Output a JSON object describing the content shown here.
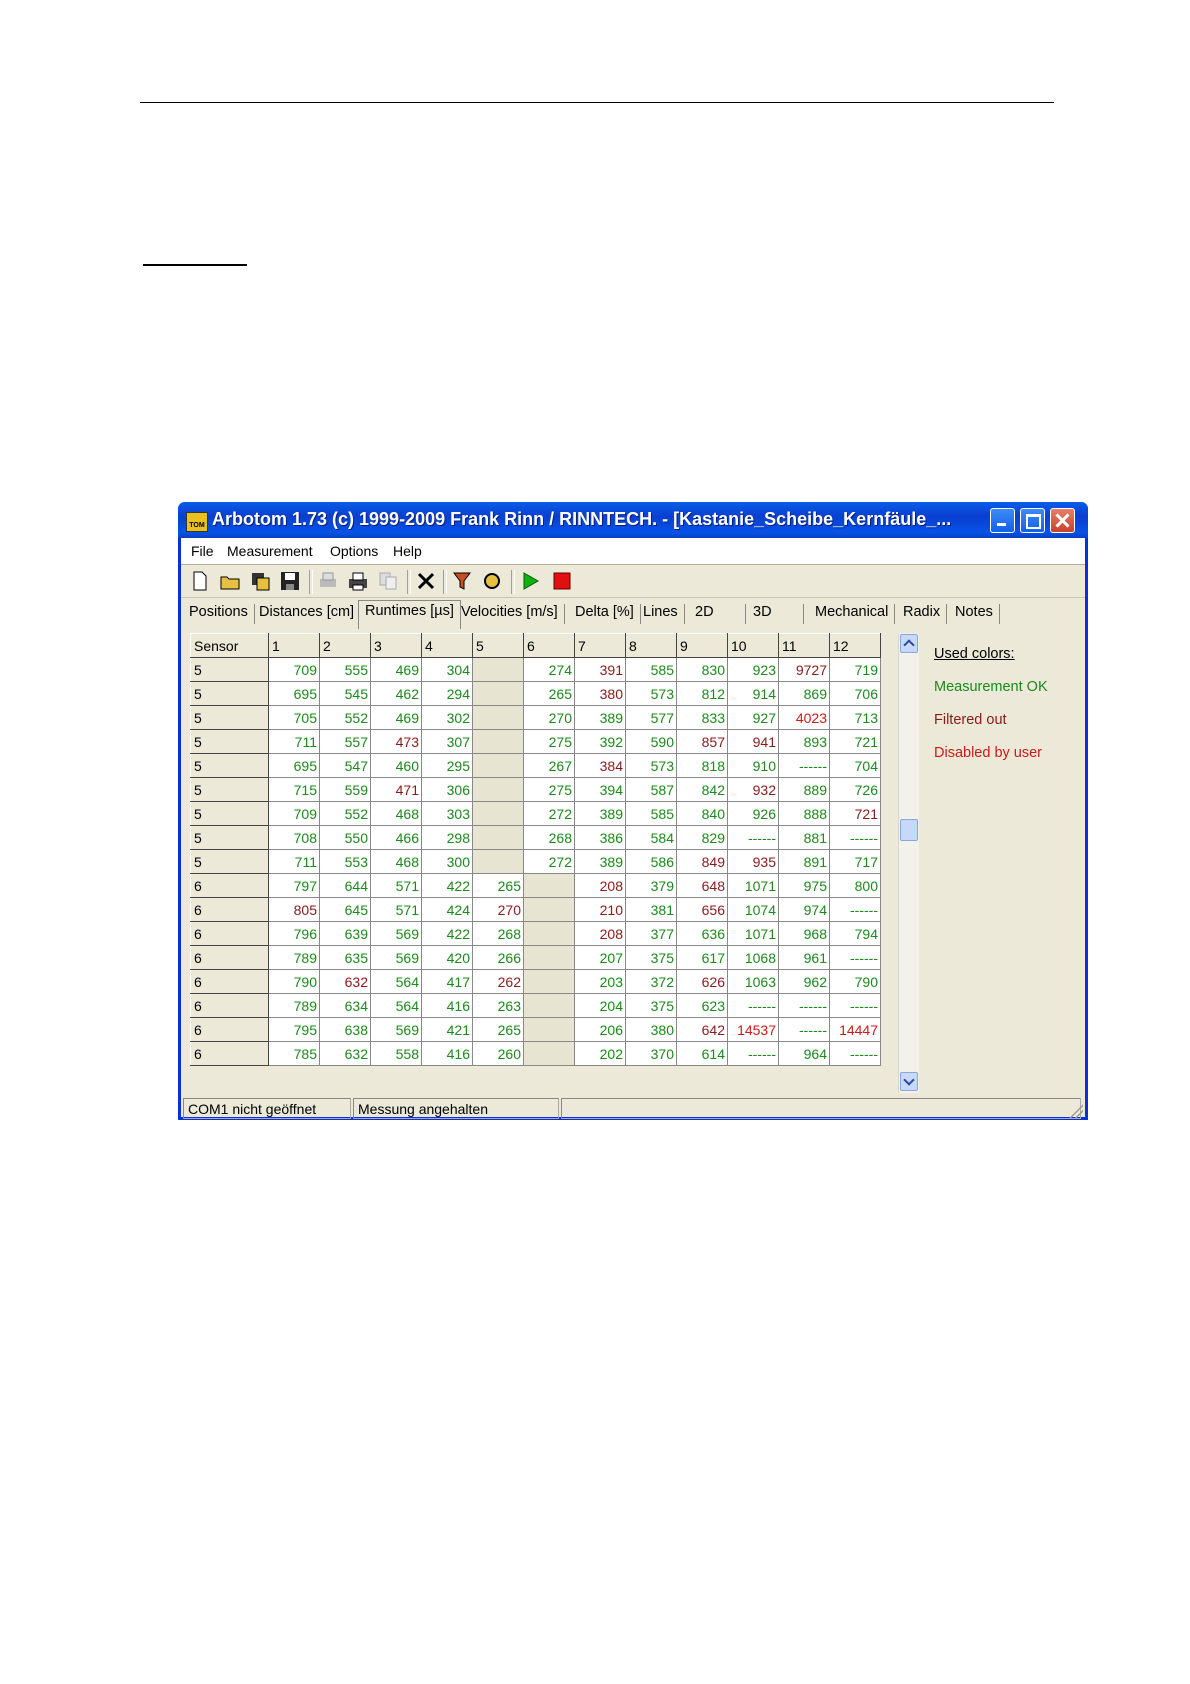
{
  "window": {
    "title": "Arbotom 1.73 (c) 1999-2009 Frank Rinn / RINNTECH.  - [Kastanie_Scheibe_Kernfäule_...",
    "icon_label": "TOM"
  },
  "menu": [
    "File",
    "Measurement",
    "Options",
    "Help"
  ],
  "toolbar": [
    "new-file-icon",
    "open-folder-icon",
    "save-all-icon",
    "save-icon",
    "print-preview-icon",
    "print-icon",
    "copy-icon",
    "delete-icon",
    "filter-icon",
    "refresh-icon",
    "play-icon",
    "stop-icon"
  ],
  "tabs": [
    "Positions",
    "Distances [cm]",
    "Runtimes [µs]",
    "Velocities [m/s]",
    "Delta [%]",
    "Lines",
    "2D",
    "3D",
    "Mechanical",
    "Radix",
    "Notes"
  ],
  "active_tab": "Runtimes [µs]",
  "grid": {
    "headers": [
      "Sensor",
      "1",
      "2",
      "3",
      "4",
      "5",
      "6",
      "7",
      "8",
      "9",
      "10",
      "11",
      "12"
    ],
    "rows": [
      {
        "sensor": "5",
        "cells": [
          [
            "709",
            "ok"
          ],
          [
            "555",
            "ok"
          ],
          [
            "469",
            "ok"
          ],
          [
            "304",
            "ok"
          ],
          [
            "",
            "blank"
          ],
          [
            "274",
            "ok"
          ],
          [
            "391",
            "filt"
          ],
          [
            "585",
            "ok"
          ],
          [
            "830",
            "ok"
          ],
          [
            "923",
            "ok"
          ],
          [
            "9727",
            "filt"
          ],
          [
            "719",
            "ok"
          ]
        ]
      },
      {
        "sensor": "5",
        "cells": [
          [
            "695",
            "ok"
          ],
          [
            "545",
            "ok"
          ],
          [
            "462",
            "ok"
          ],
          [
            "294",
            "ok"
          ],
          [
            "",
            "blank"
          ],
          [
            "265",
            "ok"
          ],
          [
            "380",
            "filt"
          ],
          [
            "573",
            "ok"
          ],
          [
            "812",
            "ok"
          ],
          [
            "914",
            "ok"
          ],
          [
            "869",
            "ok"
          ],
          [
            "706",
            "ok"
          ]
        ]
      },
      {
        "sensor": "5",
        "cells": [
          [
            "705",
            "ok"
          ],
          [
            "552",
            "ok"
          ],
          [
            "469",
            "ok"
          ],
          [
            "302",
            "ok"
          ],
          [
            "",
            "blank"
          ],
          [
            "270",
            "ok"
          ],
          [
            "389",
            "ok"
          ],
          [
            "577",
            "ok"
          ],
          [
            "833",
            "ok"
          ],
          [
            "927",
            "ok"
          ],
          [
            "4023",
            "dis"
          ],
          [
            "713",
            "ok"
          ]
        ]
      },
      {
        "sensor": "5",
        "cells": [
          [
            "711",
            "ok"
          ],
          [
            "557",
            "ok"
          ],
          [
            "473",
            "filt"
          ],
          [
            "307",
            "ok"
          ],
          [
            "",
            "blank"
          ],
          [
            "275",
            "ok"
          ],
          [
            "392",
            "ok"
          ],
          [
            "590",
            "ok"
          ],
          [
            "857",
            "filt"
          ],
          [
            "941",
            "filt"
          ],
          [
            "893",
            "ok"
          ],
          [
            "721",
            "ok"
          ]
        ]
      },
      {
        "sensor": "5",
        "cells": [
          [
            "695",
            "ok"
          ],
          [
            "547",
            "ok"
          ],
          [
            "460",
            "ok"
          ],
          [
            "295",
            "ok"
          ],
          [
            "",
            "blank"
          ],
          [
            "267",
            "ok"
          ],
          [
            "384",
            "filt"
          ],
          [
            "573",
            "ok"
          ],
          [
            "818",
            "ok"
          ],
          [
            "910",
            "ok"
          ],
          [
            "------",
            "ok"
          ],
          [
            "704",
            "ok"
          ]
        ]
      },
      {
        "sensor": "5",
        "cells": [
          [
            "715",
            "ok"
          ],
          [
            "559",
            "ok"
          ],
          [
            "471",
            "filt"
          ],
          [
            "306",
            "ok"
          ],
          [
            "",
            "blank"
          ],
          [
            "275",
            "ok"
          ],
          [
            "394",
            "ok"
          ],
          [
            "587",
            "ok"
          ],
          [
            "842",
            "ok"
          ],
          [
            "932",
            "filt"
          ],
          [
            "889",
            "ok"
          ],
          [
            "726",
            "ok"
          ]
        ]
      },
      {
        "sensor": "5",
        "cells": [
          [
            "709",
            "ok"
          ],
          [
            "552",
            "ok"
          ],
          [
            "468",
            "ok"
          ],
          [
            "303",
            "ok"
          ],
          [
            "",
            "blank"
          ],
          [
            "272",
            "ok"
          ],
          [
            "389",
            "ok"
          ],
          [
            "585",
            "ok"
          ],
          [
            "840",
            "ok"
          ],
          [
            "926",
            "ok"
          ],
          [
            "888",
            "ok"
          ],
          [
            "721",
            "filt"
          ]
        ]
      },
      {
        "sensor": "5",
        "cells": [
          [
            "708",
            "ok"
          ],
          [
            "550",
            "ok"
          ],
          [
            "466",
            "ok"
          ],
          [
            "298",
            "ok"
          ],
          [
            "",
            "blank"
          ],
          [
            "268",
            "ok"
          ],
          [
            "386",
            "ok"
          ],
          [
            "584",
            "ok"
          ],
          [
            "829",
            "ok"
          ],
          [
            "------",
            "ok"
          ],
          [
            "881",
            "ok"
          ],
          [
            "------",
            "ok"
          ]
        ]
      },
      {
        "sensor": "5",
        "cells": [
          [
            "711",
            "ok"
          ],
          [
            "553",
            "ok"
          ],
          [
            "468",
            "ok"
          ],
          [
            "300",
            "ok"
          ],
          [
            "",
            "blank"
          ],
          [
            "272",
            "ok"
          ],
          [
            "389",
            "ok"
          ],
          [
            "586",
            "ok"
          ],
          [
            "849",
            "filt"
          ],
          [
            "935",
            "filt"
          ],
          [
            "891",
            "ok"
          ],
          [
            "717",
            "ok"
          ]
        ]
      },
      {
        "sensor": "6",
        "cells": [
          [
            "797",
            "ok"
          ],
          [
            "644",
            "ok"
          ],
          [
            "571",
            "ok"
          ],
          [
            "422",
            "ok"
          ],
          [
            "265",
            "ok"
          ],
          [
            "",
            "blank"
          ],
          [
            "208",
            "filt"
          ],
          [
            "379",
            "ok"
          ],
          [
            "648",
            "filt"
          ],
          [
            "1071",
            "ok"
          ],
          [
            "975",
            "ok"
          ],
          [
            "800",
            "ok"
          ]
        ]
      },
      {
        "sensor": "6",
        "cells": [
          [
            "805",
            "filt"
          ],
          [
            "645",
            "ok"
          ],
          [
            "571",
            "ok"
          ],
          [
            "424",
            "ok"
          ],
          [
            "270",
            "filt"
          ],
          [
            "",
            "blank"
          ],
          [
            "210",
            "filt"
          ],
          [
            "381",
            "ok"
          ],
          [
            "656",
            "filt"
          ],
          [
            "1074",
            "ok"
          ],
          [
            "974",
            "ok"
          ],
          [
            "------",
            "ok"
          ]
        ]
      },
      {
        "sensor": "6",
        "cells": [
          [
            "796",
            "ok"
          ],
          [
            "639",
            "ok"
          ],
          [
            "569",
            "ok"
          ],
          [
            "422",
            "ok"
          ],
          [
            "268",
            "ok"
          ],
          [
            "",
            "blank"
          ],
          [
            "208",
            "filt"
          ],
          [
            "377",
            "ok"
          ],
          [
            "636",
            "ok"
          ],
          [
            "1071",
            "ok"
          ],
          [
            "968",
            "ok"
          ],
          [
            "794",
            "ok"
          ]
        ]
      },
      {
        "sensor": "6",
        "cells": [
          [
            "789",
            "ok"
          ],
          [
            "635",
            "ok"
          ],
          [
            "569",
            "ok"
          ],
          [
            "420",
            "ok"
          ],
          [
            "266",
            "ok"
          ],
          [
            "",
            "blank"
          ],
          [
            "207",
            "ok"
          ],
          [
            "375",
            "ok"
          ],
          [
            "617",
            "ok"
          ],
          [
            "1068",
            "ok"
          ],
          [
            "961",
            "ok"
          ],
          [
            "------",
            "ok"
          ]
        ]
      },
      {
        "sensor": "6",
        "cells": [
          [
            "790",
            "ok"
          ],
          [
            "632",
            "filt"
          ],
          [
            "564",
            "ok"
          ],
          [
            "417",
            "ok"
          ],
          [
            "262",
            "filt"
          ],
          [
            "",
            "blank"
          ],
          [
            "203",
            "ok"
          ],
          [
            "372",
            "ok"
          ],
          [
            "626",
            "filt"
          ],
          [
            "1063",
            "ok"
          ],
          [
            "962",
            "ok"
          ],
          [
            "790",
            "ok"
          ]
        ]
      },
      {
        "sensor": "6",
        "cells": [
          [
            "789",
            "ok"
          ],
          [
            "634",
            "ok"
          ],
          [
            "564",
            "ok"
          ],
          [
            "416",
            "ok"
          ],
          [
            "263",
            "ok"
          ],
          [
            "",
            "blank"
          ],
          [
            "204",
            "ok"
          ],
          [
            "375",
            "ok"
          ],
          [
            "623",
            "ok"
          ],
          [
            "------",
            "ok"
          ],
          [
            "------",
            "ok"
          ],
          [
            "------",
            "ok"
          ]
        ]
      },
      {
        "sensor": "6",
        "cells": [
          [
            "795",
            "ok"
          ],
          [
            "638",
            "ok"
          ],
          [
            "569",
            "ok"
          ],
          [
            "421",
            "ok"
          ],
          [
            "265",
            "ok"
          ],
          [
            "",
            "blank"
          ],
          [
            "206",
            "ok"
          ],
          [
            "380",
            "ok"
          ],
          [
            "642",
            "filt"
          ],
          [
            "14537",
            "dis"
          ],
          [
            "------",
            "ok"
          ],
          [
            "14447",
            "dis"
          ]
        ]
      },
      {
        "sensor": "6",
        "cells": [
          [
            "785",
            "ok"
          ],
          [
            "632",
            "ok"
          ],
          [
            "558",
            "ok"
          ],
          [
            "416",
            "ok"
          ],
          [
            "260",
            "ok"
          ],
          [
            "",
            "blank"
          ],
          [
            "202",
            "ok"
          ],
          [
            "370",
            "ok"
          ],
          [
            "614",
            "ok"
          ],
          [
            "------",
            "ok"
          ],
          [
            "964",
            "ok"
          ],
          [
            "------",
            "ok"
          ]
        ]
      }
    ]
  },
  "legend": {
    "title": "Used colors:",
    "ok": "Measurement OK",
    "filtered": "Filtered out",
    "disabled": "Disabled by user",
    "colors": {
      "ok": "#1a8a1a",
      "filtered": "#8b1a1a",
      "disabled": "#d01818"
    }
  },
  "status": {
    "port": "COM1 nicht geöffnet",
    "measurement": "Messung angehalten",
    "extra": ""
  }
}
